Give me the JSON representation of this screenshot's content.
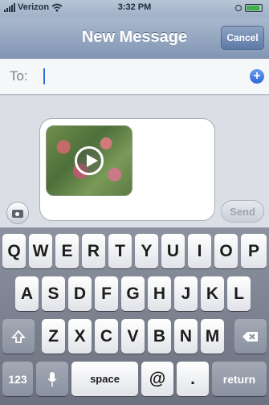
{
  "status": {
    "carrier": "Verizon",
    "time": "3:32 PM"
  },
  "nav": {
    "title": "New Message",
    "cancel": "Cancel"
  },
  "recipient": {
    "label": "To:",
    "value": ""
  },
  "compose": {
    "attachment": "video thumbnail",
    "send": "Send"
  },
  "keyboard": {
    "row1": [
      "Q",
      "W",
      "E",
      "R",
      "T",
      "Y",
      "U",
      "I",
      "O",
      "P"
    ],
    "row2": [
      "A",
      "S",
      "D",
      "F",
      "G",
      "H",
      "J",
      "K",
      "L"
    ],
    "row3": [
      "Z",
      "X",
      "C",
      "V",
      "B",
      "N",
      "M"
    ],
    "row4": {
      "numbers": "123",
      "space": "space",
      "at": "@",
      "dot": ".",
      "return": "return"
    }
  },
  "icons": [
    "signal-bars-icon",
    "wifi-icon",
    "lock-icon",
    "battery-icon",
    "add-contact-icon",
    "camera-icon",
    "play-icon",
    "shift-icon",
    "backspace-icon",
    "microphone-icon"
  ],
  "colors": {
    "nav": "#8296b4",
    "accent": "#2d68d8",
    "battery": "#3fb04a"
  }
}
